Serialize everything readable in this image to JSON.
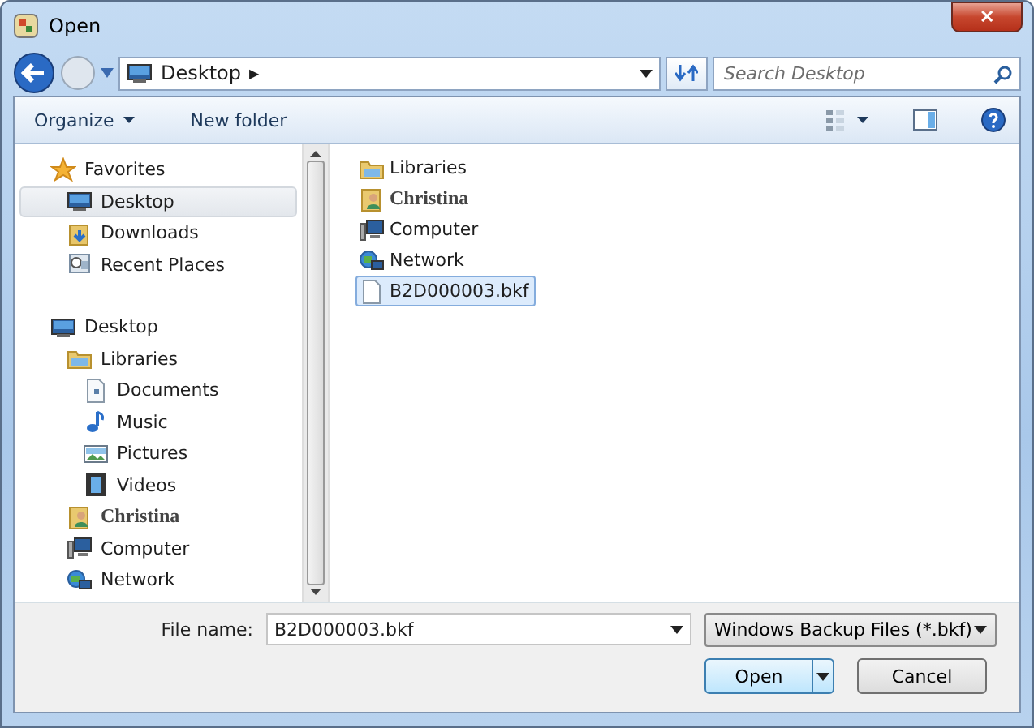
{
  "window": {
    "title": "Open",
    "close": "✕"
  },
  "address": {
    "location": "Desktop",
    "separator": "▶"
  },
  "search": {
    "placeholder": "Search Desktop"
  },
  "toolbar": {
    "organize": "Organize",
    "new_folder": "New folder"
  },
  "sidebar": {
    "groups": [
      {
        "label": "Favorites",
        "kind": "star",
        "children": [
          {
            "label": "Desktop",
            "kind": "desktop",
            "selected": true
          },
          {
            "label": "Downloads",
            "kind": "downloads",
            "selected": false
          },
          {
            "label": "Recent Places",
            "kind": "recent",
            "selected": false
          }
        ]
      },
      {
        "label": "Desktop",
        "kind": "desktop",
        "children": [
          {
            "label": "Libraries",
            "kind": "library",
            "selected": false,
            "children": [
              {
                "label": "Documents",
                "kind": "document",
                "selected": false
              },
              {
                "label": "Music",
                "kind": "music",
                "selected": false
              },
              {
                "label": "Pictures",
                "kind": "pictures",
                "selected": false
              },
              {
                "label": "Videos",
                "kind": "videos",
                "selected": false
              }
            ]
          },
          {
            "label": "Christina",
            "kind": "user",
            "selected": false
          },
          {
            "label": "Computer",
            "kind": "computer",
            "selected": false
          },
          {
            "label": "Network",
            "kind": "network",
            "selected": false
          }
        ]
      }
    ]
  },
  "files": [
    {
      "name": "Libraries",
      "kind": "library",
      "selected": false
    },
    {
      "name": "Christina",
      "kind": "user",
      "selected": false
    },
    {
      "name": "Computer",
      "kind": "computer",
      "selected": false
    },
    {
      "name": "Network",
      "kind": "network",
      "selected": false
    },
    {
      "name": "B2D000003.bkf",
      "kind": "file",
      "selected": true
    }
  ],
  "footer": {
    "file_name_label": "File name:",
    "file_name": "B2D000003.bkf",
    "file_type": "Windows Backup Files (*.bkf)",
    "open": "Open",
    "cancel": "Cancel"
  }
}
